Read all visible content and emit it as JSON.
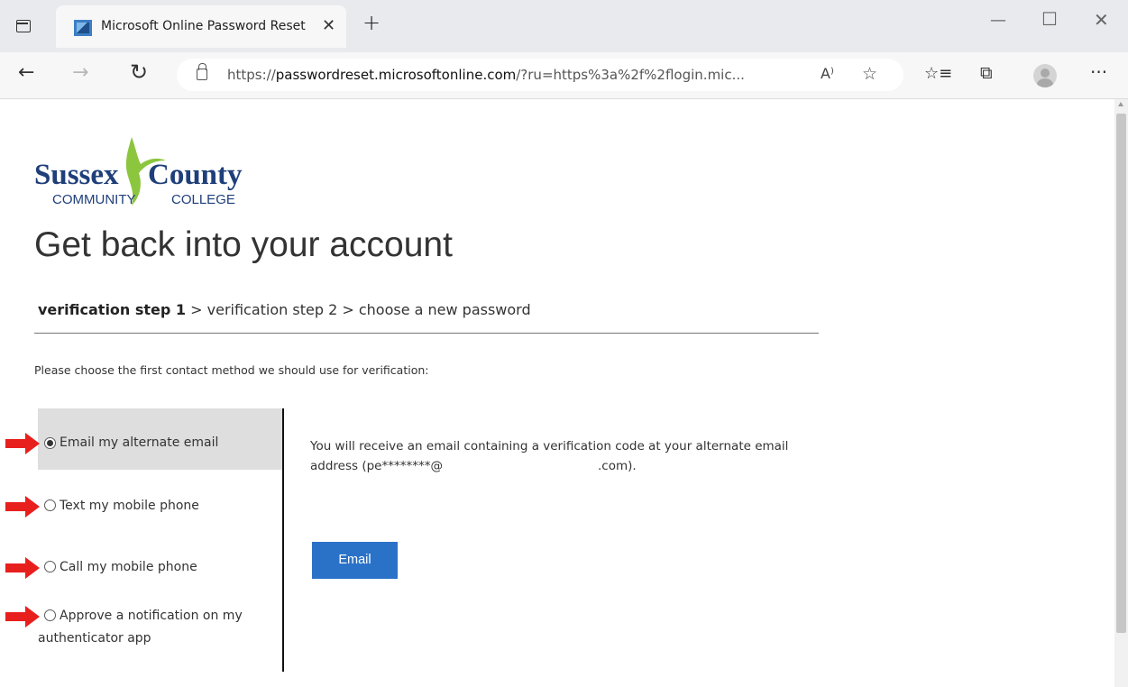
{
  "browser": {
    "tab_title": "Microsoft Online Password Reset",
    "url_prefix": "https://",
    "url_domain": "passwordreset.microsoftonline.com",
    "url_rest": "/?ru=https%3a%2f%2flogin.mic...",
    "read_aloud_glyph": "A⁾",
    "icons": [
      "tab-actions-icon",
      "microsoft-favicon",
      "close-icon",
      "new-tab-icon",
      "minimize-icon",
      "maximize-icon",
      "window-close-icon",
      "back-icon",
      "forward-icon",
      "refresh-icon",
      "lock-icon",
      "read-aloud-icon",
      "add-favorite-icon",
      "favorites-icon",
      "collections-icon",
      "profile-avatar",
      "more-icon"
    ]
  },
  "logo": {
    "line1_left": "Sussex",
    "line1_right": "County",
    "line2_left": "COMMUNITY",
    "line2_right": "COLLEGE",
    "colors": {
      "navy": "#1f3f7a",
      "green": "#8cc63f"
    }
  },
  "page": {
    "title": "Get back into your account",
    "steps": {
      "current": "verification step 1",
      "separator": " > ",
      "step2": "verification step 2",
      "step3": "choose a new password"
    },
    "instructions": "Please choose the first contact method we should use for verification:",
    "options": [
      {
        "label": "Email my alternate email",
        "selected": true
      },
      {
        "label": "Text my mobile phone",
        "selected": false
      },
      {
        "label": "Call my mobile phone",
        "selected": false
      },
      {
        "label_line1": "Approve a notification on my",
        "label_line2": "authenticator app",
        "selected": false
      }
    ],
    "description": {
      "line1": "You will receive an email containing a verification code at your alternate email",
      "line2_start": "address (pe********@",
      "line2_end": ".com)."
    },
    "email_button": "Email",
    "accent_color": "#2a72c8",
    "annotation_arrow_color": "#e8201d"
  }
}
